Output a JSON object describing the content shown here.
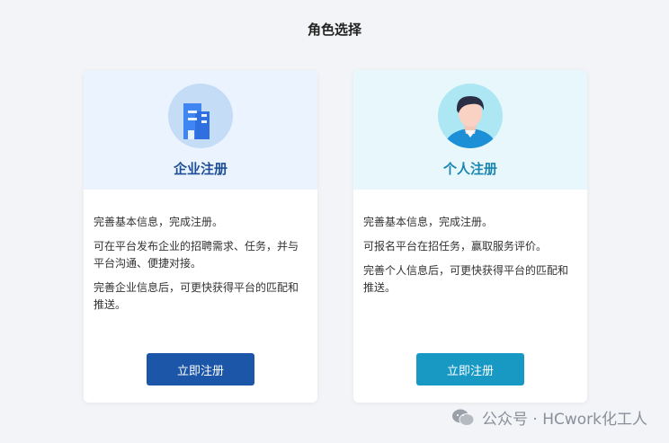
{
  "page": {
    "title": "角色选择"
  },
  "cards": [
    {
      "title": "企业注册",
      "icon": "building-icon",
      "lines": [
        "完善基本信息，完成注册。",
        "可在平台发布企业的招聘需求、任务，并与平台沟通、便捷对接。",
        "完善企业信息后，可更快获得平台的匹配和推送。"
      ],
      "button": "立即注册",
      "accent": "#1c56a8"
    },
    {
      "title": "个人注册",
      "icon": "person-icon",
      "lines": [
        "完善基本信息，完成注册。",
        "可报名平台在招任务，赢取服务评价。",
        "完善个人信息后，可更快获得平台的匹配和推送。"
      ],
      "button": "立即注册",
      "accent": "#1899c4"
    }
  ],
  "watermark": {
    "text": "公众号 · HCwork化工人",
    "icon": "wechat-icon"
  }
}
